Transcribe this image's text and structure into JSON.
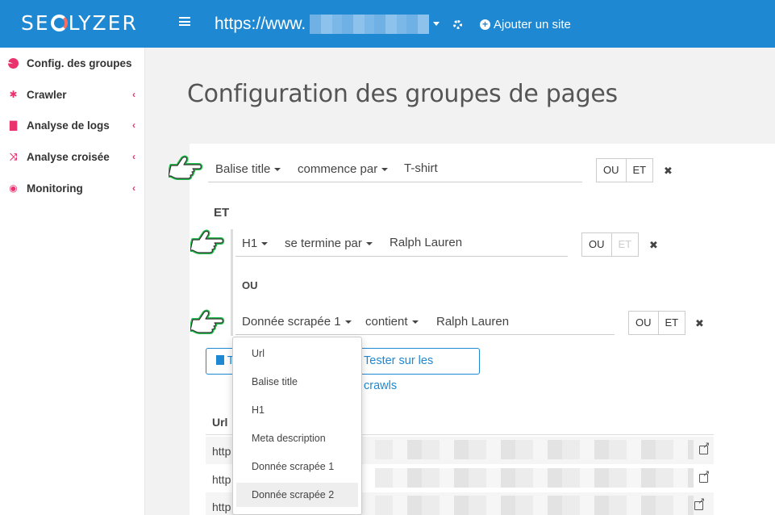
{
  "topbar": {
    "logo": "SEOLYZER",
    "site_url": "https://www.",
    "add_site_label": "Ajouter un site"
  },
  "sidebar": {
    "items": [
      {
        "label": "Config. des groupes",
        "icon": "pie-chart-icon"
      },
      {
        "label": "Crawler",
        "icon": "bug-icon"
      },
      {
        "label": "Analyse de logs",
        "icon": "file-icon"
      },
      {
        "label": "Analyse croisée",
        "icon": "shuffle-icon"
      },
      {
        "label": "Monitoring",
        "icon": "eye-icon"
      }
    ]
  },
  "page": {
    "title": "Configuration des groupes de pages"
  },
  "rules": [
    {
      "field": "Balise title",
      "operator": "commence par",
      "value": "T-shirt",
      "or": "OU",
      "and": "ET"
    },
    {
      "field": "H1",
      "operator": "se termine par",
      "value": "Ralph Lauren",
      "or": "OU",
      "and": "ET"
    },
    {
      "field": "Donnée scrapée 1",
      "operator": "contient",
      "value": "Ralph Lauren",
      "or": "OU",
      "and": "ET"
    }
  ],
  "connectors": {
    "and": "ET",
    "or": "OU"
  },
  "actions": {
    "first_button": "T",
    "test_button": "Tester sur les crawls"
  },
  "table": {
    "header": "Url",
    "rows": [
      "http",
      "http",
      "http"
    ]
  },
  "dropdown": {
    "items": [
      "Url",
      "Balise title",
      "H1",
      "Meta description",
      "Donnée scrapée 1",
      "Donnée scrapée 2"
    ],
    "active": "Donnée scrapée 2"
  },
  "colors": {
    "topbar": "#1e88d2",
    "accent": "#e8336d",
    "pointer": "#22c04a"
  }
}
